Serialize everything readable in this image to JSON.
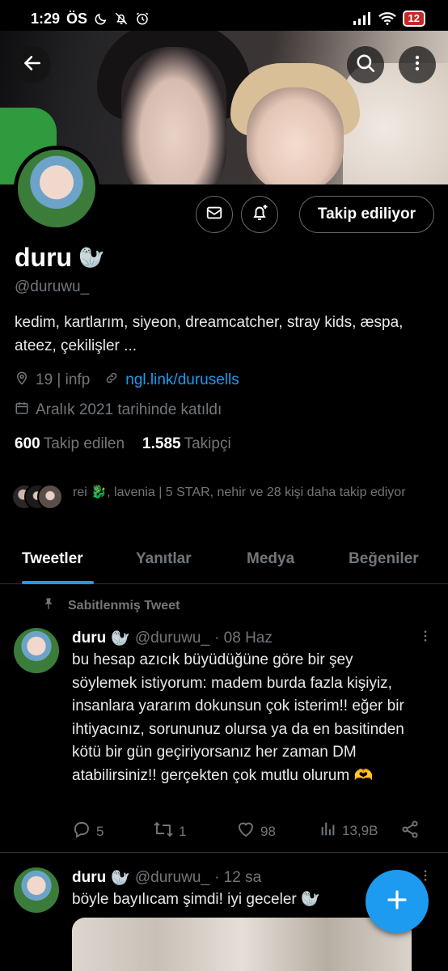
{
  "status_bar": {
    "time": "1:29",
    "carrier": "ÖS",
    "battery": "12"
  },
  "profile": {
    "name": "duru",
    "name_emoji": "🦭",
    "handle": "@duruwu_",
    "bio": "kedim, kartlarım, siyeon, dreamcatcher, stray kids, æspa, ateez, çekilişler ...",
    "location": "19 | infp",
    "link": "ngl.link/durusells",
    "joined": "Aralık 2021 tarihinde katıldı",
    "following_count": "600",
    "following_label": "Takip edilen",
    "followers_count": "1.585",
    "followers_label": "Takipçi",
    "follow_button": "Takip ediliyor",
    "mutual_followers": "rei 🐉, lavenia | 5 STAR, nehir ve 28 kişi daha takip ediyor"
  },
  "tabs": [
    "Tweetler",
    "Yanıtlar",
    "Medya",
    "Beğeniler"
  ],
  "active_tab": "Tweetler",
  "pinned_label": "Sabitlenmiş Tweet",
  "tweets": [
    {
      "name": "duru",
      "emoji": "🦭",
      "handle": "@duruwu_",
      "time": "· 08 Haz",
      "text": "bu hesap azıcık büyüdüğüne göre bir şey söylemek istiyorum: madem burda fazla kişiyiz, insanlara yararım dokunsun çok isterim!! eğer bir ihtiyacınız, sorununuz olursa ya da en basitinden kötü bir gün geçiriyorsanız her zaman DM atabilirsiniz!! gerçekten çok mutlu olurum 🫶",
      "replies": "5",
      "retweets": "1",
      "likes": "98",
      "views": "13,9B"
    },
    {
      "name": "duru",
      "emoji": "🦭",
      "handle": "@duruwu_",
      "time": "· 12 sa",
      "text": "böyle bayılıcam şimdi! iyi geceler 🦭"
    }
  ],
  "colors": {
    "accent": "#1d9bf0",
    "background": "#000000",
    "secondary_text": "#71767b"
  },
  "icons": [
    "back-arrow-icon",
    "search-icon",
    "more-vertical-icon",
    "mail-icon",
    "bell-plus-icon",
    "location-icon",
    "link-icon",
    "calendar-icon",
    "pin-icon",
    "reply-icon",
    "retweet-icon",
    "like-icon",
    "views-icon",
    "share-icon",
    "compose-plus-icon"
  ]
}
